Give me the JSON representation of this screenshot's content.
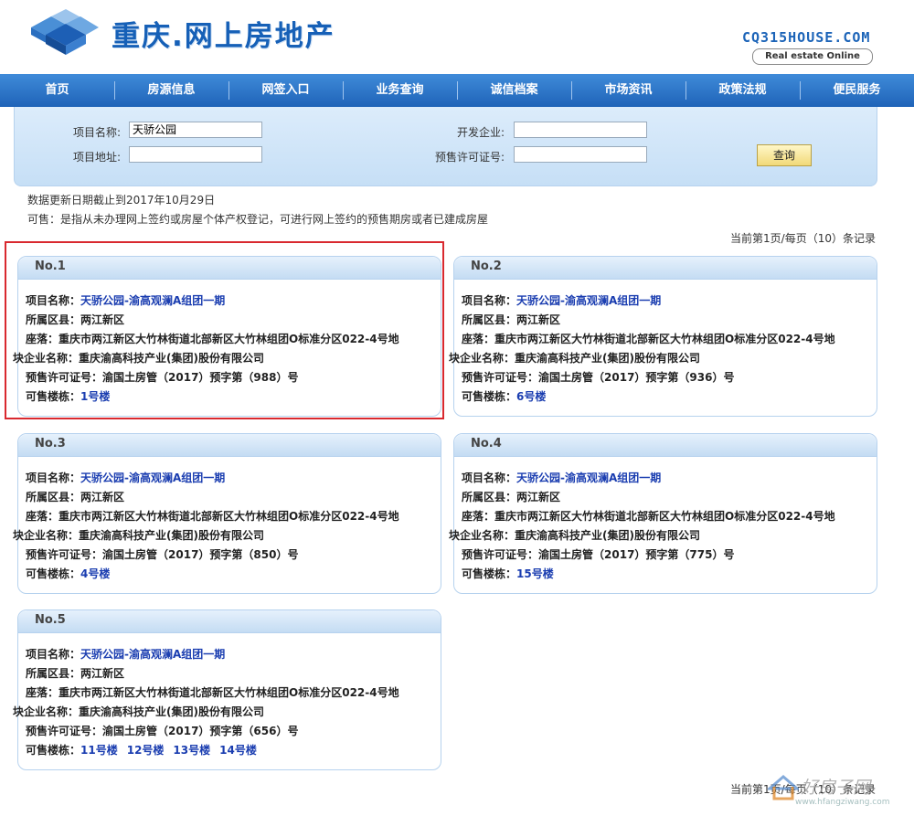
{
  "header": {
    "site_title": "重庆.网上房地产",
    "brand_domain": "CQ315HOUSE.COM",
    "brand_tagline": "Real estate Online"
  },
  "nav": [
    "首页",
    "房源信息",
    "网签入口",
    "业务查询",
    "诚信档案",
    "市场资讯",
    "政策法规",
    "便民服务"
  ],
  "search": {
    "project_name_label": "项目名称:",
    "project_name_value": "天骄公园",
    "developer_label": "开发企业:",
    "developer_value": "",
    "address_label": "项目地址:",
    "address_value": "",
    "permit_label": "预售许可证号:",
    "permit_value": "",
    "query_button": "查询"
  },
  "notes": {
    "update_date": "数据更新日期截止到2017年10月29日",
    "definition": "可售：是指从未办理网上签约或房屋个体产权登记，可进行网上签约的预售期房或者已建成房屋"
  },
  "page_info_top": "当前第1页/每页（10）条记录",
  "page_info_bottom": "当前第1页/每页（10）条记录",
  "labels": {
    "project": "项目名称：",
    "district": "所属区县：",
    "location": "座落：",
    "developer": "块企业名称：",
    "permit": "预售许可证号：",
    "buildings": "可售楼栋："
  },
  "records": [
    {
      "no": "No.1",
      "project": "天骄公园-渝高观澜A组团一期",
      "district": "两江新区",
      "location": "重庆市两江新区大竹林街道北部新区大竹林组团O标准分区022-4号地",
      "developer": "重庆渝高科技产业(集团)股份有限公司",
      "permit": "渝国土房管（2017）预字第（988）号",
      "buildings": [
        "1号楼"
      ]
    },
    {
      "no": "No.2",
      "project": "天骄公园-渝高观澜A组团一期",
      "district": "两江新区",
      "location": "重庆市两江新区大竹林街道北部新区大竹林组团O标准分区022-4号地",
      "developer": "重庆渝高科技产业(集团)股份有限公司",
      "permit": "渝国土房管（2017）预字第（936）号",
      "buildings": [
        "6号楼"
      ]
    },
    {
      "no": "No.3",
      "project": "天骄公园-渝高观澜A组团一期",
      "district": "两江新区",
      "location": "重庆市两江新区大竹林街道北部新区大竹林组团O标准分区022-4号地",
      "developer": "重庆渝高科技产业(集团)股份有限公司",
      "permit": "渝国土房管（2017）预字第（850）号",
      "buildings": [
        "4号楼"
      ]
    },
    {
      "no": "No.4",
      "project": "天骄公园-渝高观澜A组团一期",
      "district": "两江新区",
      "location": "重庆市两江新区大竹林街道北部新区大竹林组团O标准分区022-4号地",
      "developer": "重庆渝高科技产业(集团)股份有限公司",
      "permit": "渝国土房管（2017）预字第（775）号",
      "buildings": [
        "15号楼"
      ]
    },
    {
      "no": "No.5",
      "project": "天骄公园-渝高观澜A组团一期",
      "district": "两江新区",
      "location": "重庆市两江新区大竹林街道北部新区大竹林组团O标准分区022-4号地",
      "developer": "重庆渝高科技产业(集团)股份有限公司",
      "permit": "渝国土房管（2017）预字第（656）号",
      "buildings": [
        "11号楼",
        "12号楼",
        "13号楼",
        "14号楼"
      ]
    }
  ],
  "watermark": {
    "text": "好房子网",
    "url": "www.hfangziwang.com"
  },
  "colors": {
    "nav_bg": "#1f63b8",
    "title_blue": "#1660b7",
    "link_blue": "#1a3db0",
    "highlight_red": "#d9292f"
  }
}
